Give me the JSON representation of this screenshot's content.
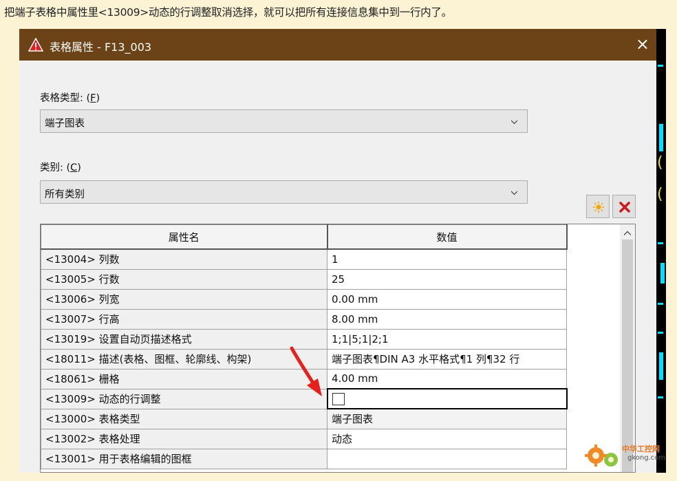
{
  "caption": "把端子表格中属性里<13009>动态的行调整取消选择，就可以把所有连接信息集中到一行内了。",
  "dialog": {
    "title": "表格属性 - F13_003",
    "close_label": "×",
    "table_type": {
      "label": "表格类型: (",
      "key": "F",
      "label_end": ")",
      "value": "端子图表"
    },
    "category": {
      "label": "类别: (",
      "key": "C",
      "label_end": ")",
      "value": "所有类别"
    },
    "buttons": {
      "new_icon": "sun-icon",
      "delete_icon": "x-icon"
    },
    "grid": {
      "headers": [
        "属性名",
        "数值"
      ],
      "rows": [
        {
          "name": "<13004> 列数",
          "value": "1"
        },
        {
          "name": "<13005> 行数",
          "value": "25"
        },
        {
          "name": "<13006> 列宽",
          "value": "0.00 mm"
        },
        {
          "name": "<13007> 行高",
          "value": "8.00 mm"
        },
        {
          "name": "<13019> 设置自动页描述格式",
          "value": "1;1|5;1|2;1"
        },
        {
          "name": "<18011> 描述(表格、图框、轮廓线、构架)",
          "value": "端子图表¶DIN A3 水平格式¶1 列¶32 行"
        },
        {
          "name": "<18061> 栅格",
          "value": "4.00 mm"
        },
        {
          "name": "<13009> 动态的行调整",
          "value": "",
          "checkbox": false
        },
        {
          "name": "<13000> 表格类型",
          "value": "端子图表"
        },
        {
          "name": "<13002> 表格处理",
          "value": "动态"
        },
        {
          "name": "<13001> 用于表格编辑的图框",
          "value": ""
        }
      ]
    }
  },
  "watermark": {
    "line1": "中华工控网",
    "line2": "gkong.com"
  },
  "colors": {
    "titlebar": "#6b4316",
    "page_bg": "#fbf3d4",
    "annotation_arrow": "#e8201c"
  }
}
